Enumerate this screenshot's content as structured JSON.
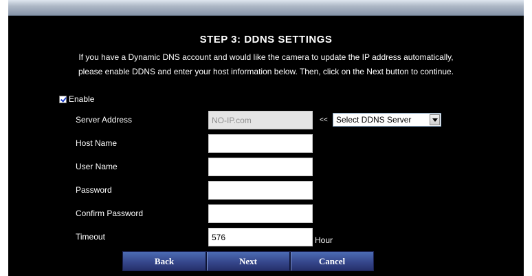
{
  "page": {
    "title": "STEP 3: DDNS SETTINGS",
    "description_line1": "If you have a Dynamic DNS account and would like the camera to update the IP address automatically,",
    "description_line2": "please enable DDNS and enter your host information below. Then, click on the Next button to continue."
  },
  "enable": {
    "label": "Enable",
    "checked": true
  },
  "fields": {
    "server_address": {
      "label": "Server Address",
      "value": "NO-IP.com"
    },
    "host_name": {
      "label": "Host Name",
      "value": ""
    },
    "user_name": {
      "label": "User Name",
      "value": ""
    },
    "password": {
      "label": "Password",
      "value": ""
    },
    "confirm_password": {
      "label": "Confirm Password",
      "value": ""
    },
    "timeout": {
      "label": "Timeout",
      "value": "576",
      "unit": "Hour"
    }
  },
  "ddns_server": {
    "arrows": "<<",
    "selected": "Select DDNS Server"
  },
  "buttons": {
    "back": "Back",
    "next": "Next",
    "cancel": "Cancel"
  },
  "colors": {
    "background": "#000000",
    "button_bar": "#36478c",
    "check_mark": "#1a3cc8"
  }
}
